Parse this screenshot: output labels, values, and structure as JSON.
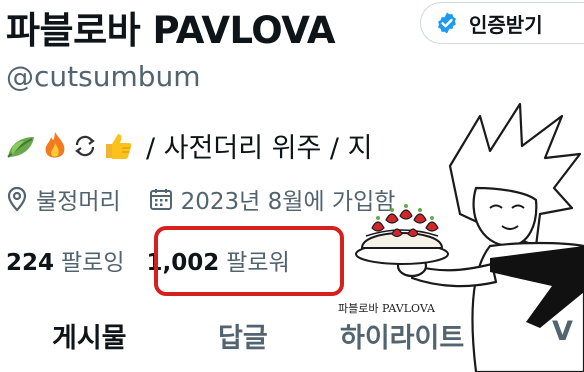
{
  "profile": {
    "display_name": "파블로바 PAVLOVA",
    "handle": "@cutsumbum",
    "bio_text": "/ 사전더리 위주 / 지",
    "bio_emoji": [
      "leaf-icon",
      "fire-icon",
      "repeat-icon",
      "thumbs-up-icon"
    ]
  },
  "verify_button": {
    "label": "인증받기",
    "icon": "verified-badge-icon",
    "color": "#1d9bf0"
  },
  "meta": {
    "location": "불정머리",
    "joined": "2023년 8월에 가입함"
  },
  "stats": {
    "following_count": "224",
    "following_label": "팔로잉",
    "followers_count": "1,002",
    "followers_label": "팔로워"
  },
  "tabs": [
    {
      "label": "게시물",
      "active": true
    },
    {
      "label": "답글",
      "active": false
    },
    {
      "label": "하이라이트",
      "active": false
    },
    {
      "label": "V",
      "active": false
    }
  ],
  "artwork": {
    "signature": "파블로바 PAVLOVA"
  },
  "colors": {
    "highlight_box": "#d61f1f",
    "secondary_text": "#536471",
    "primary_text": "#0f1419"
  }
}
